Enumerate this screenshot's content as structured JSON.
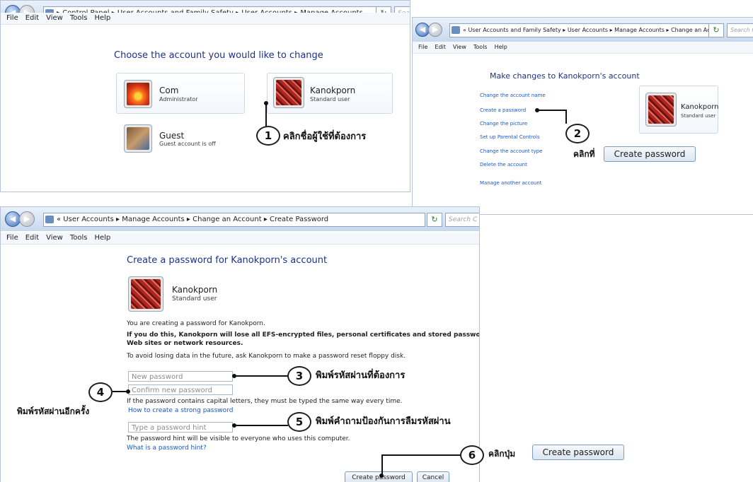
{
  "windows": {
    "w1": {
      "address": [
        "Control Panel",
        "User Accounts and Family Safety",
        "User Accounts",
        "Manage Accounts"
      ],
      "search_placeholder": "Sea",
      "menu": [
        "File",
        "Edit",
        "View",
        "Tools",
        "Help"
      ],
      "heading": "Choose the account you would like to change",
      "accounts": [
        {
          "name": "Com",
          "role": "Administrator"
        },
        {
          "name": "Kanokporn",
          "role": "Standard user"
        },
        {
          "name": "Guest",
          "role": "Guest account is off"
        }
      ]
    },
    "w2": {
      "address": [
        "User Accounts and Family Safety",
        "User Accounts",
        "Manage Accounts",
        "Change an Account"
      ],
      "search_placeholder": "Search Cont",
      "menu": [
        "File",
        "Edit",
        "View",
        "Tools",
        "Help"
      ],
      "heading": "Make changes to Kanokporn's account",
      "links": [
        "Change the account name",
        "Create a password",
        "Change the picture",
        "Set up Parental Controls",
        "Change the account type",
        "Delete the account"
      ],
      "manage_other": "Manage another account",
      "account": {
        "name": "Kanokporn",
        "role": "Standard user"
      }
    },
    "w3": {
      "address": [
        "User Accounts",
        "Manage Accounts",
        "Change an Account",
        "Create Password"
      ],
      "search_placeholder": "Search C",
      "menu": [
        "File",
        "Edit",
        "View",
        "Tools",
        "Help"
      ],
      "heading": "Create a password for Kanokporn's account",
      "account": {
        "name": "Kanokporn",
        "role": "Standard user"
      },
      "info1": "You are creating a password for Kanokporn.",
      "warning1": "If you do this, Kanokporn will lose all EFS-encrypted files, personal certificates and stored passwords for",
      "warning2": "Web sites or network resources.",
      "info2": "To avoid losing data in the future, ask Kanokporn to make a password reset floppy disk.",
      "new_password_placeholder": "New password",
      "confirm_password_placeholder": "Confirm new password",
      "caps_note": "If the password contains capital letters, they must be typed the same way every time.",
      "strong_link": "How to create a strong password",
      "hint_placeholder": "Type a password hint",
      "hint_note": "The password hint will be visible to everyone who uses this computer.",
      "hint_link": "What is a password hint?",
      "create_button": "Create password",
      "cancel_button": "Cancel"
    }
  },
  "annotations": {
    "c1": "1",
    "t1": "คลิกชื่อผู้ใช้ที่ต้องการ",
    "c2": "2",
    "t2": "คลิกที่",
    "b2": "Create password",
    "c3": "3",
    "t3": "พิมพ์รหัสผ่านที่ต้องการ",
    "c4": "4",
    "t4": "พิมพ์รหัสผ่านอีกครั้ง",
    "c5": "5",
    "t5": "พิมพ์คำถามป้องกันการลืมรหัสผ่าน",
    "c6": "6",
    "t6": "คลิกปุ่ม",
    "b6": "Create password"
  }
}
